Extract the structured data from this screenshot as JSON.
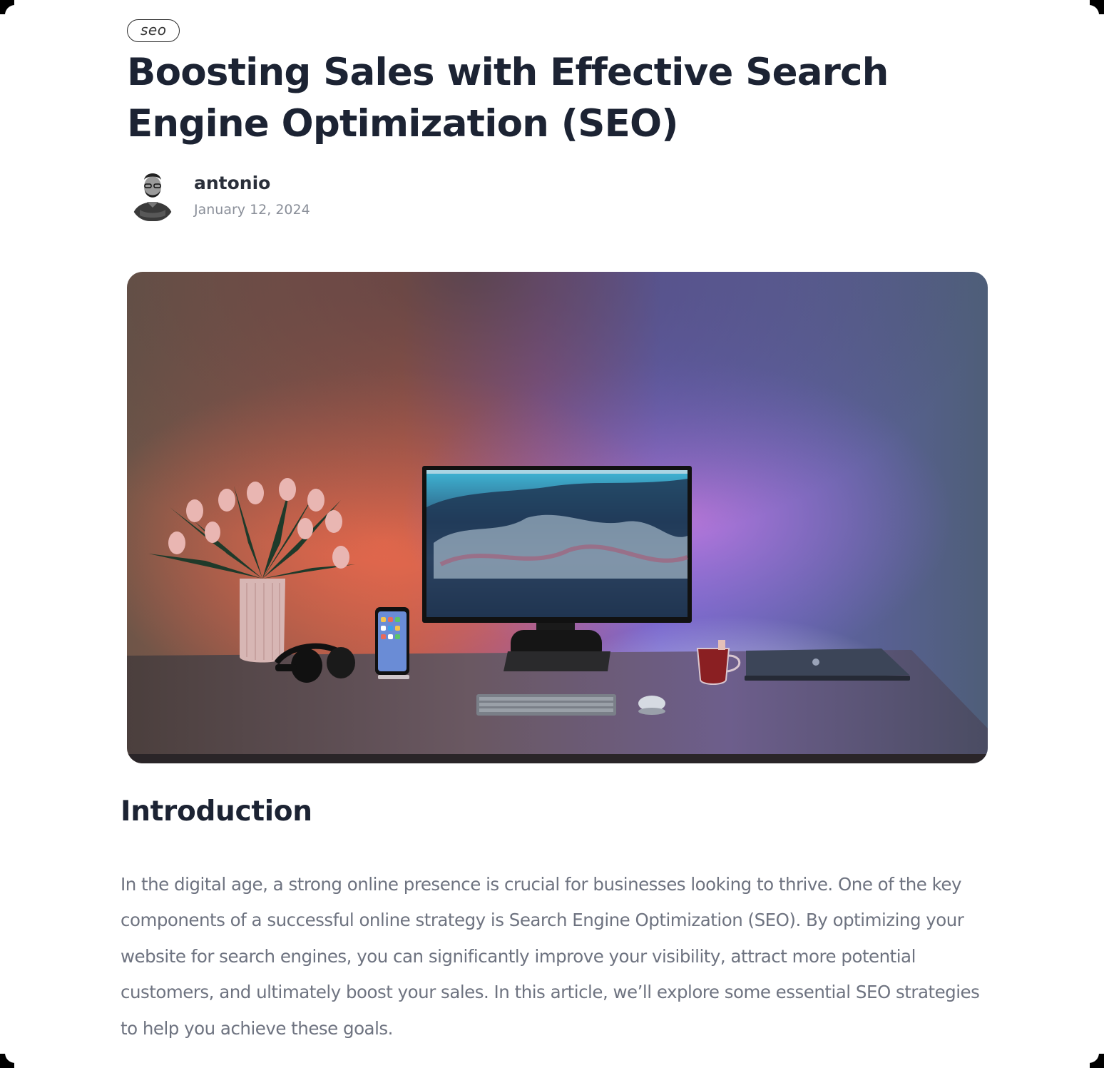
{
  "article": {
    "tag": "seo",
    "title": "Boosting Sales with Effective Search Engine Optimization (SEO)",
    "author": {
      "name": "antonio",
      "date": "January 12, 2024",
      "avatar_icon": "person-avatar"
    },
    "hero_image": {
      "icon": "desk-setup-photo"
    },
    "sections": [
      {
        "heading": "Introduction",
        "body": "In the digital age, a strong online presence is crucial for businesses looking to thrive. One of the key components of a successful online strategy is Search Engine Optimization (SEO). By optimizing your website for search engines, you can significantly improve your visibility, attract more potential customers, and ultimately boost your sales. In this article, we’ll explore some essential SEO strategies to help you achieve these goals."
      }
    ]
  },
  "colors": {
    "text_primary": "#1c2333",
    "text_muted": "#6e7380",
    "date": "#8a8f99"
  }
}
